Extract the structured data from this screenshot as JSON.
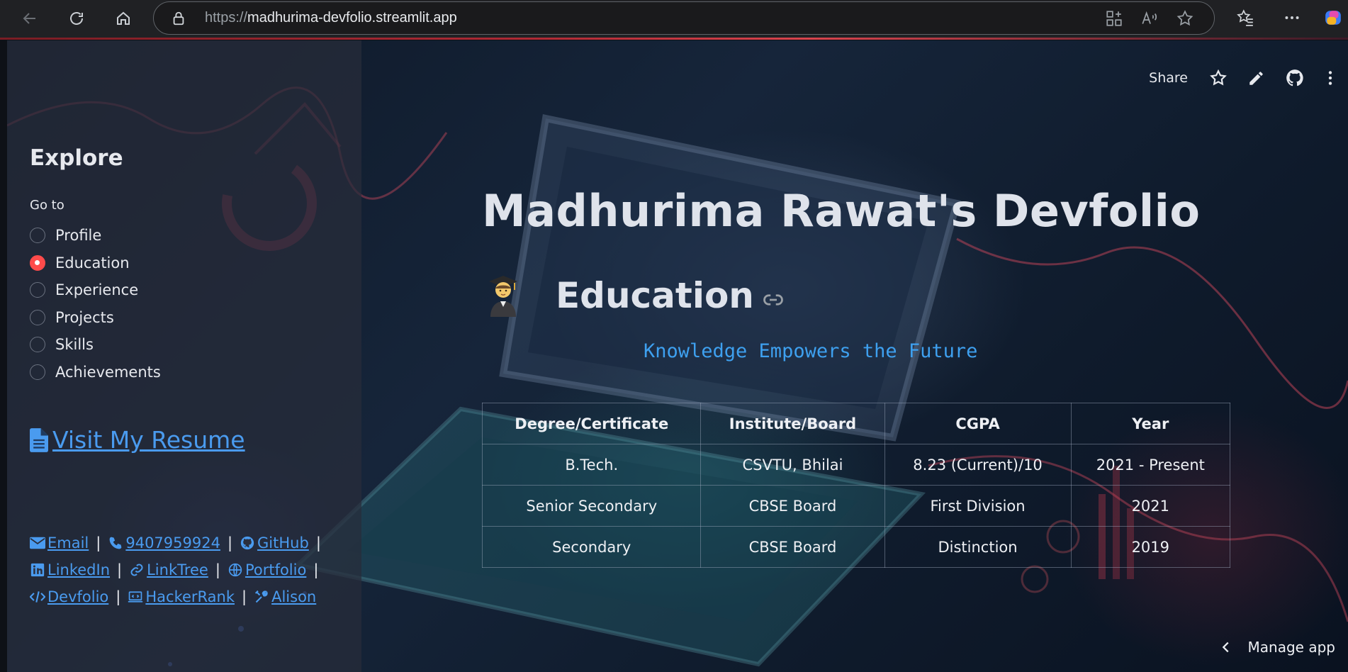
{
  "browser": {
    "url_scheme": "https://",
    "url_host": "madhurima-devfolio.streamlit.app"
  },
  "sidebar": {
    "title": "Explore",
    "goto_label": "Go to",
    "nav_items": [
      {
        "label": "Profile",
        "selected": false
      },
      {
        "label": "Education",
        "selected": true
      },
      {
        "label": "Experience",
        "selected": false
      },
      {
        "label": "Projects",
        "selected": false
      },
      {
        "label": "Skills",
        "selected": false
      },
      {
        "label": "Achievements",
        "selected": false
      }
    ],
    "resume_link": "Visit My Resume",
    "links": {
      "email": "Email",
      "phone": "9407959924",
      "github": "GitHub",
      "linkedin": "LinkedIn",
      "linktree": "LinkTree",
      "portfolio": "Portfolio",
      "devfolio": "Devfolio",
      "hackerrank": "HackerRank",
      "alison": "Alison"
    },
    "separator": "|"
  },
  "header": {
    "share_label": "Share"
  },
  "main": {
    "page_title": "Madhurima Rawat's Devfolio",
    "section_title": "Education",
    "tagline": "Knowledge Empowers the Future",
    "table": {
      "headers": [
        "Degree/Certificate",
        "Institute/Board",
        "CGPA",
        "Year"
      ],
      "rows": [
        [
          "B.Tech.",
          "CSVTU, Bhilai",
          "8.23 (Current)/10",
          "2021 - Present"
        ],
        [
          "Senior Secondary",
          "CBSE Board",
          "First Division",
          "2021"
        ],
        [
          "Secondary",
          "CBSE Board",
          "Distinction",
          "2019"
        ]
      ]
    }
  },
  "footer": {
    "manage_app": "Manage app"
  },
  "colors": {
    "accent": "#ff4b4b",
    "link": "#4a9bef",
    "tagline": "#3ea0ef"
  }
}
